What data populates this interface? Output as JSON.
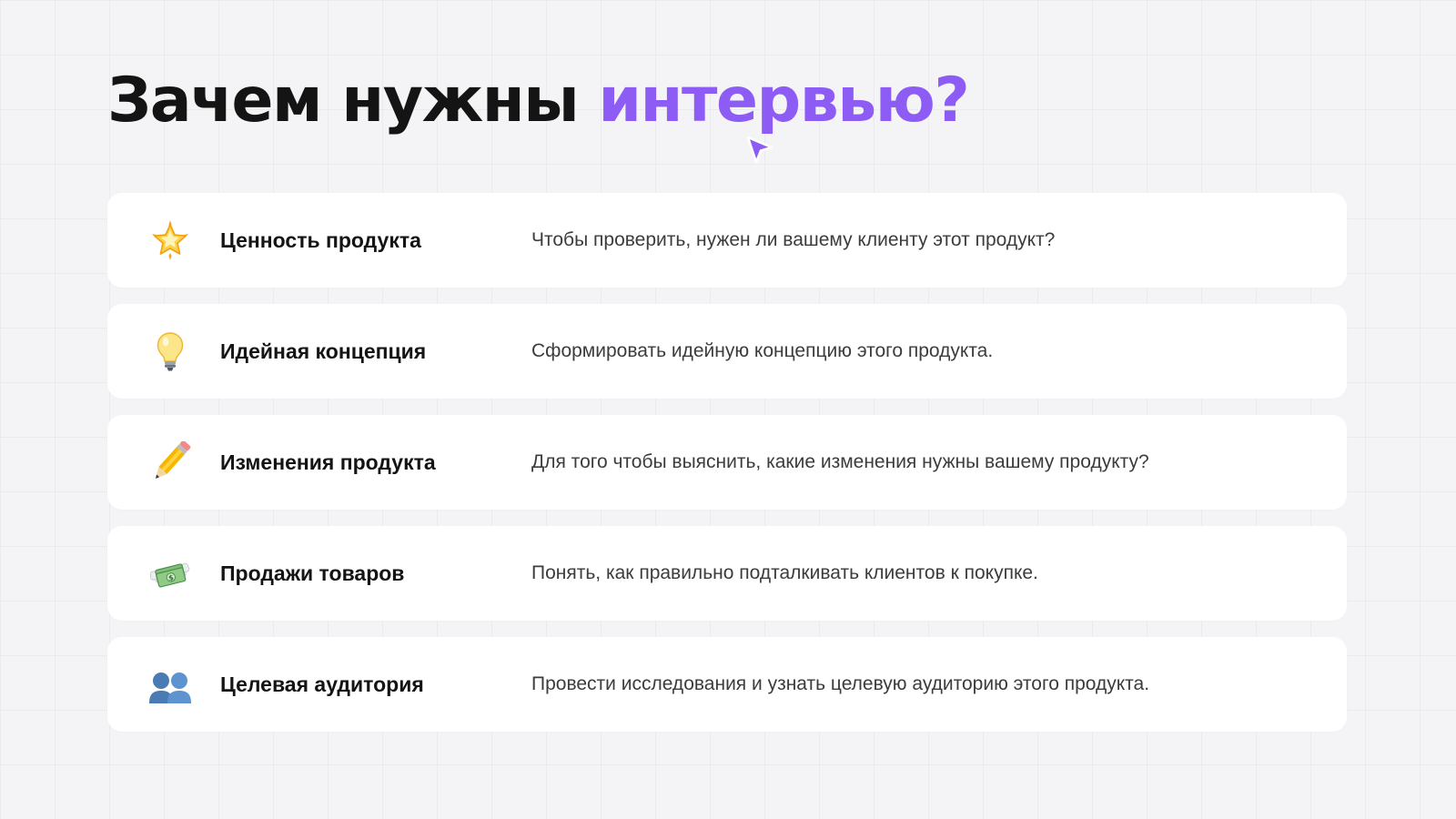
{
  "slide": {
    "title_main": "Зачем нужны ",
    "title_accent": "интервью?",
    "accent_color": "#8c5cf5",
    "items": [
      {
        "icon": "glowing-star-icon",
        "label": "Ценность продукта",
        "description": "Чтобы проверить, нужен ли вашему клиенту этот продукт?"
      },
      {
        "icon": "light-bulb-icon",
        "label": "Идейная концепция",
        "description": "Сформировать идейную концепцию этого продукта."
      },
      {
        "icon": "pencil-icon",
        "label": "Изменения продукта",
        "description": "Для того чтобы выяснить, какие изменения нужны вашему продукту?"
      },
      {
        "icon": "money-with-wings-icon",
        "label": "Продажи товаров",
        "description": "Понять, как правильно подталкивать клиентов к покупке."
      },
      {
        "icon": "users-silhouettes-icon",
        "label": "Целевая аудитория",
        "description": "Провести исследования и узнать целевую аудиторию этого продукта."
      }
    ]
  }
}
